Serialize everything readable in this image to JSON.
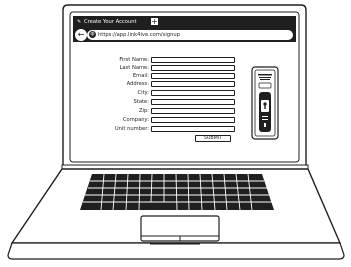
{
  "browser": {
    "tab_title": "Create Your Account",
    "tab_icon": "pencil-icon",
    "new_tab_label": "+",
    "back_icon": "back-arrow-icon",
    "address_icon": "globe-icon",
    "url": "https://app.link4ive.com/signup"
  },
  "form": {
    "fields": [
      {
        "label": "First Name:",
        "value": ""
      },
      {
        "label": "Last Name:",
        "value": ""
      },
      {
        "label": "Email:",
        "value": ""
      },
      {
        "label": "Address:",
        "value": ""
      },
      {
        "label": "City:",
        "value": ""
      },
      {
        "label": "State:",
        "value": ""
      },
      {
        "label": "Zip:",
        "value": ""
      },
      {
        "label": "Company:",
        "value": ""
      },
      {
        "label": "Unit number:",
        "value": ""
      }
    ],
    "submit_label": "SUBMIT"
  },
  "side_widget": {
    "icon": "password-manager-icon"
  },
  "colors": {
    "ink": "#1f1f1f",
    "background": "#ffffff"
  }
}
